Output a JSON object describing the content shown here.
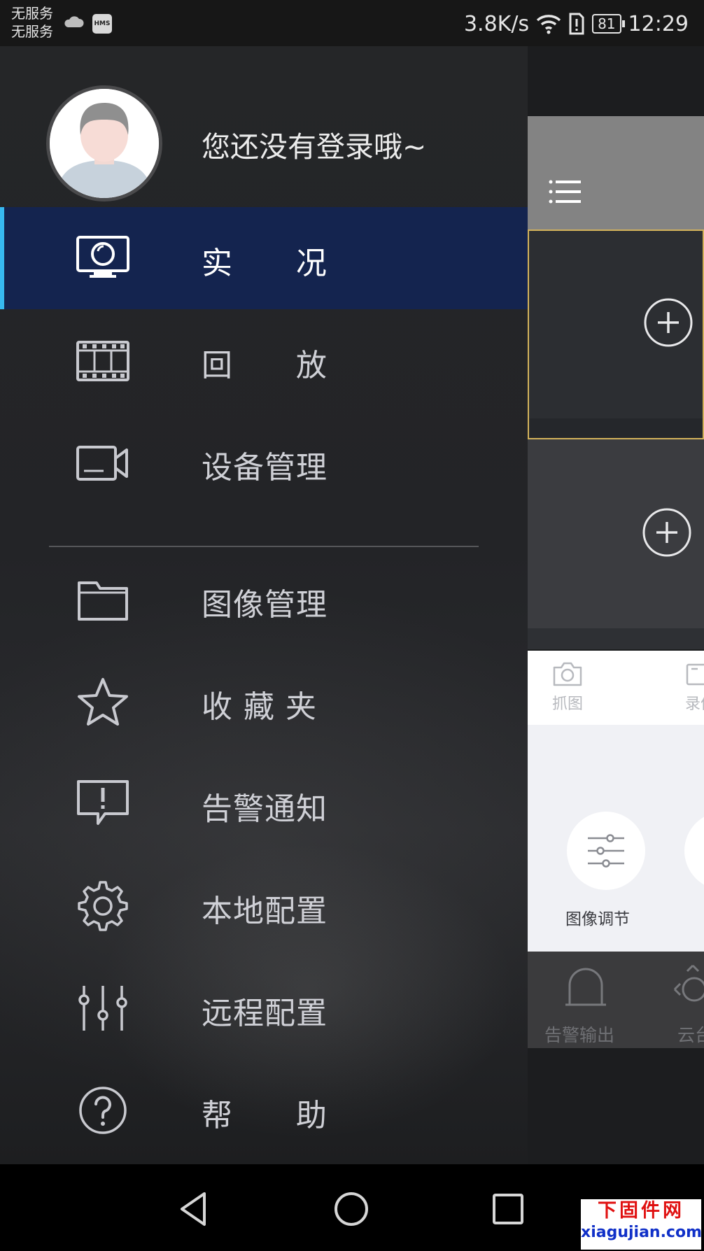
{
  "status_bar": {
    "carrier_line1": "无服务",
    "carrier_line2": "无服务",
    "hms_badge": "HMS",
    "net_speed": "3.8K/s",
    "battery": "81",
    "time": "12:29"
  },
  "drawer": {
    "login_prompt": "您还没有登录哦~",
    "items": [
      {
        "label": "实      况",
        "icon": "monitor-icon",
        "active": true
      },
      {
        "label": "回      放",
        "icon": "film-icon"
      },
      {
        "label": "设备管理",
        "icon": "camera-icon"
      },
      {
        "label": "图像管理",
        "icon": "folder-icon"
      },
      {
        "label": "收 藏 夹",
        "icon": "star-icon"
      },
      {
        "label": "告警通知",
        "icon": "alert-icon"
      },
      {
        "label": "本地配置",
        "icon": "gear-icon"
      },
      {
        "label": "远程配置",
        "icon": "sliders-icon"
      },
      {
        "label": "帮      助",
        "icon": "help-icon"
      }
    ]
  },
  "panel": {
    "tools": [
      {
        "label": "抓图",
        "icon": "camera-snap-icon"
      },
      {
        "label": "录像",
        "icon": "record-icon"
      }
    ],
    "grid_label": "图像调节",
    "bottom_items": [
      {
        "label": "告警输出",
        "icon": "alarm-bell-icon"
      },
      {
        "label": "云台",
        "icon": "ptz-icon"
      }
    ]
  },
  "watermark": {
    "line1": "下固件网",
    "line2": "xiagujian.com"
  },
  "colors": {
    "active_bg": "#14244f",
    "active_indicator": "#37b9f0",
    "selected_cell_border": "#d3b25b"
  }
}
